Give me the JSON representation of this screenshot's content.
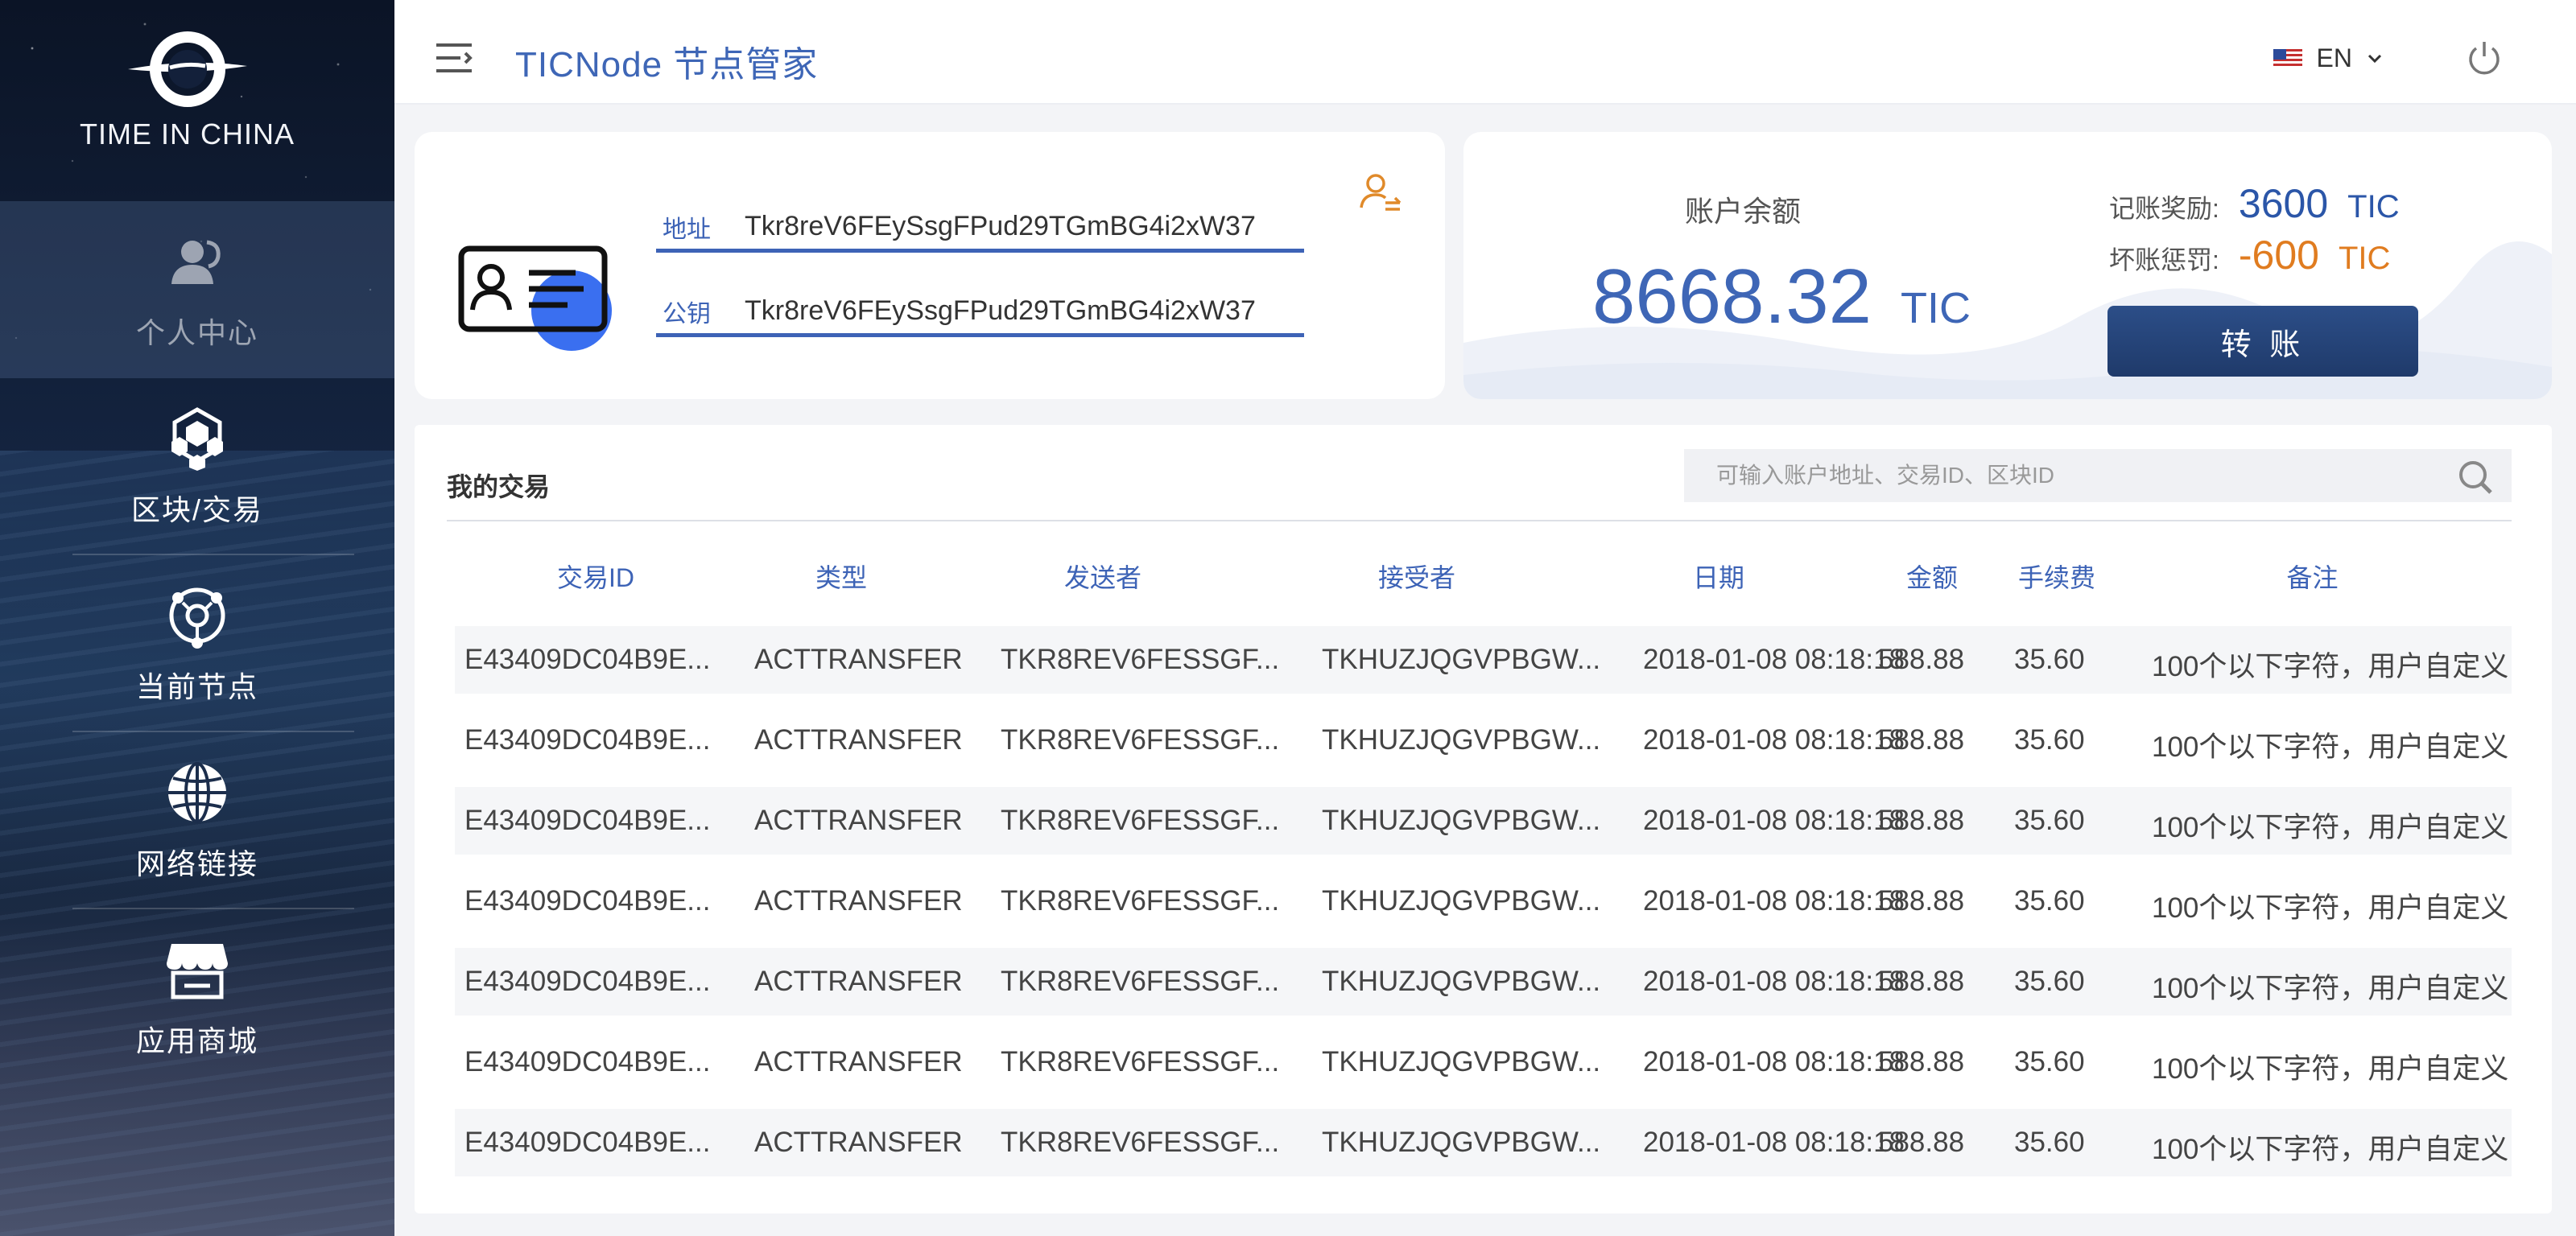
{
  "brand": {
    "name": "TIME IN CHINA"
  },
  "sidebar": {
    "items": [
      {
        "label": "个人中心"
      },
      {
        "label": "区块/交易"
      },
      {
        "label": "当前节点"
      },
      {
        "label": "网络链接"
      },
      {
        "label": "应用商城"
      }
    ]
  },
  "header": {
    "title": "TICNode 节点管家",
    "language": "EN"
  },
  "identity": {
    "address_label": "地址",
    "address_value": "Tkr8reV6FEySsgFPud29TGmBG4i2xW37",
    "pubkey_label": "公钥",
    "pubkey_value": "Tkr8reV6FEySsgFPud29TGmBG4i2xW37"
  },
  "balance": {
    "label": "账户余额",
    "value": "8668.32",
    "unit": "TIC",
    "reward_label": "记账奖励:",
    "reward_value": "3600",
    "reward_unit": "TIC",
    "penalty_label": "坏账惩罚:",
    "penalty_value": "-600",
    "penalty_unit": "TIC",
    "transfer_label": "转 账"
  },
  "transactions": {
    "title": "我的交易",
    "search_placeholder": "可输入账户地址、交易ID、区块ID",
    "columns": [
      "交易ID",
      "类型",
      "发送者",
      "接受者",
      "日期",
      "金额",
      "手续费",
      "备注"
    ],
    "rows": [
      [
        "E43409DC04B9E...",
        "ACTTRANSFER",
        "TKR8REV6FESSGF...",
        "TKHUZJQGVPBGW...",
        "2018-01-08 08:18:18",
        "588.88",
        "35.60",
        "100个以下字符，用户自定义"
      ],
      [
        "E43409DC04B9E...",
        "ACTTRANSFER",
        "TKR8REV6FESSGF...",
        "TKHUZJQGVPBGW...",
        "2018-01-08 08:18:18",
        "588.88",
        "35.60",
        "100个以下字符，用户自定义"
      ],
      [
        "E43409DC04B9E...",
        "ACTTRANSFER",
        "TKR8REV6FESSGF...",
        "TKHUZJQGVPBGW...",
        "2018-01-08 08:18:18",
        "588.88",
        "35.60",
        "100个以下字符，用户自定义"
      ],
      [
        "E43409DC04B9E...",
        "ACTTRANSFER",
        "TKR8REV6FESSGF...",
        "TKHUZJQGVPBGW...",
        "2018-01-08 08:18:18",
        "588.88",
        "35.60",
        "100个以下字符，用户自定义"
      ],
      [
        "E43409DC04B9E...",
        "ACTTRANSFER",
        "TKR8REV6FESSGF...",
        "TKHUZJQGVPBGW...",
        "2018-01-08 08:18:18",
        "588.88",
        "35.60",
        "100个以下字符，用户自定义"
      ],
      [
        "E43409DC04B9E...",
        "ACTTRANSFER",
        "TKR8REV6FESSGF...",
        "TKHUZJQGVPBGW...",
        "2018-01-08 08:18:18",
        "588.88",
        "35.60",
        "100个以下字符，用户自定义"
      ],
      [
        "E43409DC04B9E...",
        "ACTTRANSFER",
        "TKR8REV6FESSGF...",
        "TKHUZJQGVPBGW...",
        "2018-01-08 08:18:18",
        "588.88",
        "35.60",
        "100个以下字符，用户自定义"
      ]
    ]
  },
  "colors": {
    "accent": "#3e66b6",
    "penalty": "#e07c20",
    "button": "#1f3a6a"
  },
  "icons": {
    "nav": [
      "user-icon",
      "blocks-icon",
      "node-icon",
      "globe-icon",
      "store-icon"
    ],
    "header": [
      "menu-icon",
      "us-flag-icon",
      "chevron-down-icon",
      "power-icon"
    ],
    "identity": [
      "id-card-icon",
      "user-switch-icon"
    ],
    "search": "search-icon"
  }
}
